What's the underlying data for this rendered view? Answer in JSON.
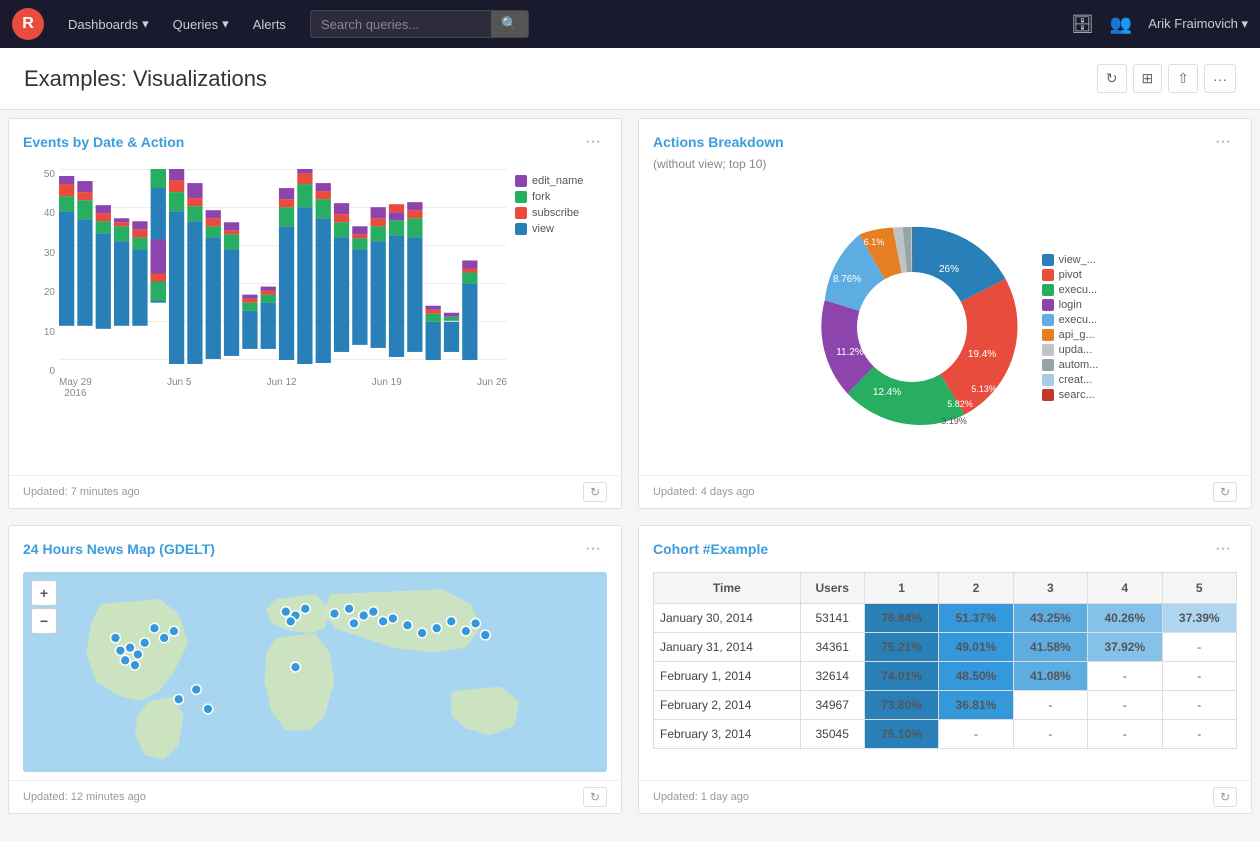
{
  "navbar": {
    "logo": "R",
    "links": [
      {
        "label": "Dashboards",
        "has_arrow": true
      },
      {
        "label": "Queries",
        "has_arrow": true
      },
      {
        "label": "Alerts",
        "has_arrow": false
      }
    ],
    "search_placeholder": "Search queries...",
    "user": "Arik Fraimovich"
  },
  "page": {
    "title": "Examples: Visualizations",
    "actions": [
      "refresh-icon",
      "expand-icon",
      "share-icon",
      "more-icon"
    ]
  },
  "widgets": {
    "events_chart": {
      "title": "Events by Date & Action",
      "updated": "Updated: 7 minutes ago",
      "legend": [
        {
          "label": "edit_name",
          "color": "#8e44ad"
        },
        {
          "label": "fork",
          "color": "#27ae60"
        },
        {
          "label": "subscribe",
          "color": "#e74c3c"
        },
        {
          "label": "view",
          "color": "#2980b9"
        }
      ],
      "y_labels": [
        "50",
        "40",
        "30",
        "20",
        "10",
        "0"
      ],
      "x_labels": [
        {
          "label": "May 29",
          "sub": "2016"
        },
        {
          "label": "Jun 5",
          "sub": ""
        },
        {
          "label": "Jun 12",
          "sub": ""
        },
        {
          "label": "Jun 19",
          "sub": ""
        },
        {
          "label": "Jun 26",
          "sub": ""
        }
      ],
      "bars": [
        {
          "view": 30,
          "subscribe": 3,
          "fork": 4,
          "edit_name": 2
        },
        {
          "view": 28,
          "subscribe": 2,
          "fork": 5,
          "edit_name": 3
        },
        {
          "view": 25,
          "subscribe": 2,
          "fork": 3,
          "edit_name": 2
        },
        {
          "view": 22,
          "subscribe": 1,
          "fork": 4,
          "edit_name": 1
        },
        {
          "view": 20,
          "subscribe": 2,
          "fork": 3,
          "edit_name": 2
        },
        {
          "view": 35,
          "subscribe": 2,
          "fork": 5,
          "edit_name": 9
        },
        {
          "view": 40,
          "subscribe": 3,
          "fork": 5,
          "edit_name": 3
        },
        {
          "view": 38,
          "subscribe": 2,
          "fork": 4,
          "edit_name": 4
        },
        {
          "view": 32,
          "subscribe": 2,
          "fork": 3,
          "edit_name": 2
        },
        {
          "view": 28,
          "subscribe": 1,
          "fork": 4,
          "edit_name": 2
        },
        {
          "view": 10,
          "subscribe": 1,
          "fork": 2,
          "edit_name": 1
        },
        {
          "view": 12,
          "subscribe": 1,
          "fork": 2,
          "edit_name": 1
        },
        {
          "view": 35,
          "subscribe": 2,
          "fork": 5,
          "edit_name": 3
        },
        {
          "view": 42,
          "subscribe": 3,
          "fork": 6,
          "edit_name": 3
        },
        {
          "view": 38,
          "subscribe": 2,
          "fork": 5,
          "edit_name": 2
        },
        {
          "view": 30,
          "subscribe": 2,
          "fork": 4,
          "edit_name": 3
        },
        {
          "view": 25,
          "subscribe": 1,
          "fork": 3,
          "edit_name": 2
        },
        {
          "view": 28,
          "subscribe": 2,
          "fork": 4,
          "edit_name": 3
        },
        {
          "view": 32,
          "subscribe": 2,
          "fork": 4,
          "edit_name": 2
        },
        {
          "view": 30,
          "subscribe": 2,
          "fork": 5,
          "edit_name": 2
        },
        {
          "view": 10,
          "subscribe": 1,
          "fork": 2,
          "edit_name": 1
        },
        {
          "view": 8,
          "subscribe": 0,
          "fork": 1,
          "edit_name": 1
        },
        {
          "view": 20,
          "subscribe": 1,
          "fork": 3,
          "edit_name": 2
        }
      ]
    },
    "actions_breakdown": {
      "title": "Actions Breakdown",
      "subtitle": "(without view; top 10)",
      "updated": "Updated: 4 days ago",
      "segments": [
        {
          "label": "view_",
          "pct": 26,
          "color": "#2980b9"
        },
        {
          "label": "pivot",
          "pct": 19.4,
          "color": "#e74c3c"
        },
        {
          "label": "execu",
          "pct": 12.4,
          "color": "#27ae60"
        },
        {
          "label": "login",
          "pct": 11.2,
          "color": "#8e44ad"
        },
        {
          "label": "execu",
          "pct": 8.76,
          "color": "#5dade2"
        },
        {
          "label": "api_g",
          "pct": 6.1,
          "color": "#e67e22"
        },
        {
          "label": "upda",
          "pct": 5.82,
          "color": "#bdc3c7"
        },
        {
          "label": "autom",
          "pct": 5.13,
          "color": "#95a5a6"
        },
        {
          "label": "creat",
          "pct": 3.19,
          "color": "#a9cce3"
        },
        {
          "label": "searc",
          "pct": 2.06,
          "color": "#c0392b"
        }
      ]
    },
    "news_map": {
      "title": "24 Hours News Map (GDELT)",
      "updated": "Updated: 12 minutes ago"
    },
    "cohort": {
      "title": "Cohort #Example",
      "updated": "Updated: 1 day ago",
      "columns": [
        "Time",
        "Users",
        "1",
        "2",
        "3",
        "4",
        "5"
      ],
      "rows": [
        {
          "time": "January 30, 2014",
          "users": "53141",
          "vals": [
            "76.84%",
            "51.37%",
            "43.25%",
            "40.26%",
            "37.39%"
          ]
        },
        {
          "time": "January 31, 2014",
          "users": "34361",
          "vals": [
            "75.21%",
            "49.01%",
            "41.58%",
            "37.92%",
            "-"
          ]
        },
        {
          "time": "February 1, 2014",
          "users": "32614",
          "vals": [
            "74.01%",
            "48.50%",
            "41.08%",
            "-",
            "-"
          ]
        },
        {
          "time": "February 2, 2014",
          "users": "34967",
          "vals": [
            "73.80%",
            "36.81%",
            "-",
            "-",
            "-"
          ]
        },
        {
          "time": "February 3, 2014",
          "users": "35045",
          "vals": [
            "75.10%",
            "-",
            "-",
            "-",
            "-"
          ]
        }
      ]
    }
  }
}
